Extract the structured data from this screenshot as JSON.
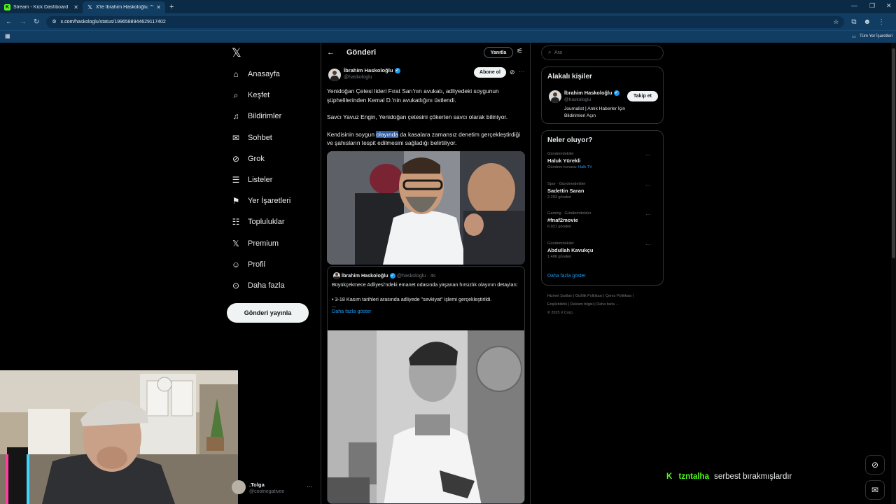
{
  "browser": {
    "tabs": [
      {
        "title": "Stream - Kick Dashboard",
        "favicon": "kick-icon",
        "active": false
      },
      {
        "title": "X'te İbrahim Haskoloğlu: \"Yeni",
        "favicon": "x-icon",
        "active": true
      }
    ],
    "url_domain": "x.com",
    "url_path": "/haskologlu/status/1996588944629117402",
    "bookmarks_label": "Tüm Yer İşaretleri"
  },
  "nav": {
    "items": [
      {
        "label": "Anasayfa",
        "icon": "home-icon",
        "glyph": "⌂"
      },
      {
        "label": "Keşfet",
        "icon": "search-icon",
        "glyph": "⌕"
      },
      {
        "label": "Bildirimler",
        "icon": "bell-icon",
        "glyph": "♫"
      },
      {
        "label": "Sohbet",
        "icon": "mail-icon",
        "glyph": "✉"
      },
      {
        "label": "Grok",
        "icon": "grok-icon",
        "glyph": "⊘"
      },
      {
        "label": "Listeler",
        "icon": "list-icon",
        "glyph": "☰"
      },
      {
        "label": "Yer İşaretleri",
        "icon": "bookmark-icon",
        "glyph": "⚑"
      },
      {
        "label": "Topluluklar",
        "icon": "communities-icon",
        "glyph": "☷"
      },
      {
        "label": "Premium",
        "icon": "x-icon",
        "glyph": "𝕏"
      },
      {
        "label": "Profil",
        "icon": "profile-icon",
        "glyph": "☺"
      },
      {
        "label": "Daha fazla",
        "icon": "more-circle-icon",
        "glyph": "⊙"
      }
    ],
    "post_button": "Gönderi yayınla",
    "account": {
      "name": ".Tolga",
      "handle": "@coolnegativee"
    }
  },
  "post": {
    "header_title": "Gönderi",
    "reply_button": "Yanıtla",
    "author_name": "İbrahim Haskoloğlu",
    "author_handle": "@haskologlu",
    "subscribe_button": "Abone ol",
    "para1": "Yenidoğan Çetesi lideri Fırat Sarı'nın avukatı, adliyedeki soygunun şüphelilerinden Kemal D.'nin avukatlığını üstlendi.",
    "para2": "Savcı Yavuz Engin, Yenidoğan çetesini çökerten savcı olarak biliniyor.",
    "para3_before": "Kendisinin soygun ",
    "para3_highlight": "olayında",
    "para3_after": " da kasalara zamansız denetim gerçekleştirdiği ve şahısların tespit edilmesini sağladığı belirtiliyor.",
    "quote": {
      "author_name": "İbrahim Haskoloğlu",
      "author_handle": "@haskologlu",
      "time": "4s",
      "line1": "Büyükçekmece Adliyesi'ndeki emanet odasında yaşanan hırsızlık olayının detayları:",
      "line2": "• 3-18 Kasım tarihleri arasında adliyede \"sevkiyat\" işlemi gerçekleştirildi.",
      "ellipsis": "...",
      "show_more": "Daha fazla göster"
    }
  },
  "sidebar": {
    "search_placeholder": "Ara",
    "relevant": {
      "title": "Alakalı kişiler",
      "name": "İbrahim Haskoloğlu",
      "handle": "@haskologlu",
      "follow_button": "Takip et",
      "bio": "Journalist | Anlık Haberler İçin Bildirimleri Açın"
    },
    "trends": {
      "title": "Neler oluyor?",
      "items": [
        {
          "category": "Gündemdekiler",
          "name": "Haluk Yürekli",
          "count_prefix": "Gündem konusu: ",
          "count_link": "Halk TV"
        },
        {
          "category": "Spor · Gündemdekiler",
          "name": "Sadettin Saran",
          "count_prefix": "2.293 gönderi",
          "count_link": ""
        },
        {
          "category": "Gaming · Gündemdekiler",
          "name": "#fnaf2movie",
          "count_prefix": "6.921 gönderi",
          "count_link": ""
        },
        {
          "category": "Gündemdekiler",
          "name": "Abdullah Kavukçu",
          "count_prefix": "1.406 gönderi",
          "count_link": ""
        }
      ],
      "show_more": "Daha fazla göster"
    },
    "footer": {
      "line1": "Hizmet Şartları  |  Gizlilik Politikası  |  Çerez Politikası  |",
      "line2": "Erişilebilirlik  |  Reklam bilgisi  |  Daha fazla ···",
      "line3": "© 2025 X Corp."
    }
  },
  "overlay": {
    "chat_user": "tzntalha",
    "chat_message": "serbest bırakmışlardır"
  },
  "colors": {
    "accent": "#1d9bf0",
    "kick_green": "#53fc18",
    "highlight": "#2c5aa0"
  }
}
